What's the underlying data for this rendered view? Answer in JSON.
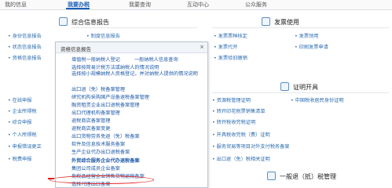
{
  "topnav": {
    "items": [
      "我的信息",
      "我要办税",
      "我要查询",
      "互动中心",
      "公众服务"
    ],
    "active_index": 1
  },
  "sections": {
    "s1": {
      "title": "综合信息报告",
      "items": [
        "身份信息报告",
        "制度信息报告",
        "状态信息报告",
        "资格信息报告",
        "其他信息报告"
      ]
    },
    "s2": {
      "title": "发票使用",
      "items": [
        "发票票种核定",
        "发票代开",
        "发票验旧缴销",
        "发票领用",
        "印刷发票申请"
      ]
    },
    "s3": {
      "title": "证明开具",
      "items": [
        "中国税收居民身份证明",
        "转开印花税票销售清单",
        "转开税收完税证明",
        "开具税收完税（费）证明",
        "服务贸易等项目对外支付税务备案",
        "出口退（免）税相关证明"
      ]
    },
    "s4": {
      "title": "一般退（抵）税管理",
      "items": [
        "在线申报",
        "企业所得税",
        "综合申报",
        "个人所得税",
        "申报错误更正",
        "税费申报"
      ]
    },
    "s5": {
      "items": [
        "资源税管理证明",
        "涉税专业服务",
        "转开税收缴款书"
      ]
    }
  },
  "popup": {
    "title": "资格信息报告",
    "close": "×",
    "items": [
      "增值税一般纳税人登记",
      "一般纳税人信息查询",
      "选择按简易计税方法或纳税人的情况说明",
      "选择按小规模纳税人资格登记，并对纳税人提供的情况说明",
      "出口退（免）税备案管理",
      "研究机构采购国产设备退税备案管理",
      "融资租赁企业出口退税备案管理",
      "出口代理机构备案管理",
      "退税商店备案管理",
      "退税商店备案变更",
      "出口货物劳务免退（免）税备案",
      "软件及信息技术服务备案",
      "生产企业代办出口退税备案",
      "外贸综合服务企业代办退税备案",
      "集团公司成员企业备案",
      "免税品经营企业销售货物退税备案",
      "选择代理出口备案"
    ]
  }
}
